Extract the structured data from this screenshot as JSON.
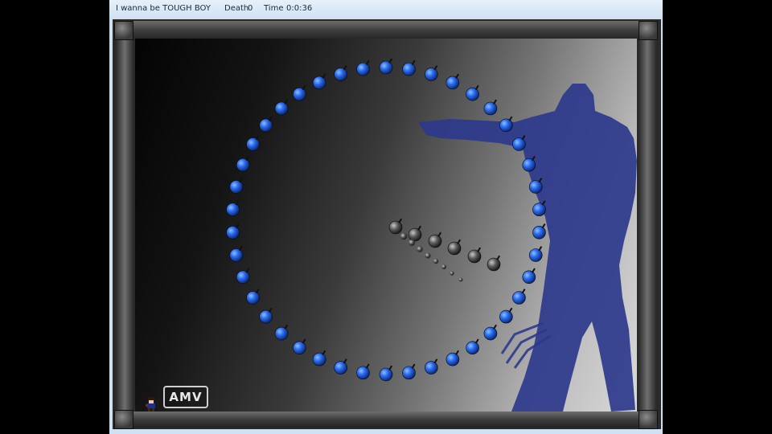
{
  "window": {
    "title_game": "I wanna be TOUGH BOY",
    "death_label": "Death",
    "death_count": "0",
    "time_label": "Time",
    "time_value": "0:0:36"
  },
  "watermark": {
    "text": "AMV"
  },
  "colors": {
    "window_chrome": "#cfe2f4",
    "bomb_blue": "#2a6cf0",
    "bomb_gray": "#5a5a5a",
    "silhouette": "#2c3a8c"
  },
  "icons": {
    "bomb_blue": "blue-bomb-icon",
    "bomb_gray": "gray-bomb-icon",
    "player": "kid-sprite-icon"
  },
  "scene": {
    "blue_bomb_ring_count": 42,
    "gray_bomb_count": 6
  }
}
